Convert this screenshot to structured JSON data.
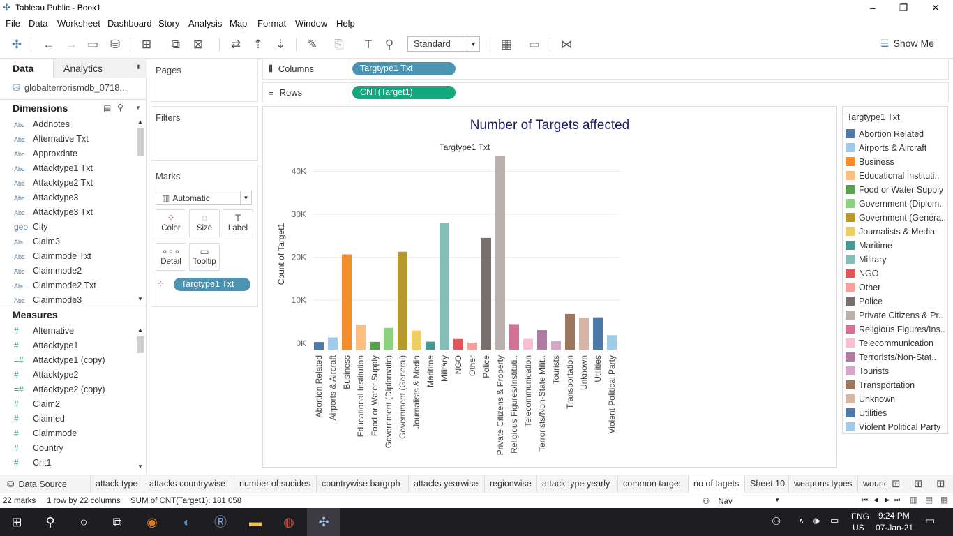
{
  "window": {
    "title": "Tableau Public - Book1"
  },
  "menu": [
    "File",
    "Data",
    "Worksheet",
    "Dashboard",
    "Story",
    "Analysis",
    "Map",
    "Format",
    "Window",
    "Help"
  ],
  "toolbar": {
    "fit_mode": "Standard",
    "show_me": "Show Me"
  },
  "left": {
    "tab_data": "Data",
    "tab_analytics": "Analytics",
    "datasource": "globalterrorismdb_0718...",
    "dimensions_label": "Dimensions",
    "dimensions": [
      {
        "type": "Abc",
        "name": "Addnotes"
      },
      {
        "type": "Abc",
        "name": "Alternative Txt"
      },
      {
        "type": "Abc",
        "name": "Approxdate"
      },
      {
        "type": "Abc",
        "name": "Attacktype1 Txt"
      },
      {
        "type": "Abc",
        "name": "Attacktype2 Txt"
      },
      {
        "type": "Abc",
        "name": "Attacktype3"
      },
      {
        "type": "Abc",
        "name": "Attacktype3 Txt"
      },
      {
        "type": "geo",
        "name": "City"
      },
      {
        "type": "Abc",
        "name": "Claim3"
      },
      {
        "type": "Abc",
        "name": "Claimmode Txt"
      },
      {
        "type": "Abc",
        "name": "Claimmode2"
      },
      {
        "type": "Abc",
        "name": "Claimmode2 Txt"
      },
      {
        "type": "Abc",
        "name": "Claimmode3"
      }
    ],
    "measures_label": "Measures",
    "measures": [
      {
        "type": "#",
        "name": "Alternative"
      },
      {
        "type": "#",
        "name": "Attacktype1"
      },
      {
        "type": "=#",
        "name": "Attacktype1 (copy)"
      },
      {
        "type": "#",
        "name": "Attacktype2"
      },
      {
        "type": "=#",
        "name": "Attacktype2 (copy)"
      },
      {
        "type": "#",
        "name": "Claim2"
      },
      {
        "type": "#",
        "name": "Claimed"
      },
      {
        "type": "#",
        "name": "Claimmode"
      },
      {
        "type": "#",
        "name": "Country"
      },
      {
        "type": "#",
        "name": "Crit1"
      }
    ]
  },
  "cards": {
    "pages": "Pages",
    "filters": "Filters",
    "marks": "Marks",
    "mark_type": "Automatic",
    "mark_buttons": [
      "Color",
      "Size",
      "Label",
      "Detail",
      "Tooltip"
    ],
    "color_pill": "Targtype1 Txt"
  },
  "shelves": {
    "columns_label": "Columns",
    "columns_pill": "Targtype1 Txt",
    "rows_label": "Rows",
    "rows_pill": "CNT(Target1)"
  },
  "chart_data": {
    "type": "bar",
    "title": "Number of Targets affected",
    "xlabel": "Targtype1 Txt",
    "ylabel": "Count of Target1",
    "ylim": [
      -1500,
      43000
    ],
    "yticks": [
      "0K",
      "10K",
      "20K",
      "30K",
      "40K"
    ],
    "ytick_values": [
      0,
      10000,
      20000,
      30000,
      40000
    ],
    "categories": [
      "Abortion Related",
      "Airports & Aircraft",
      "Business",
      "Educational Institution",
      "Food or Water Supply",
      "Government (Diplomatic)",
      "Government (General)",
      "Journalists & Media",
      "Maritime",
      "Military",
      "NGO",
      "Other",
      "Police",
      "Private Citizens & Property",
      "Religious Figures/Instituti..",
      "Telecommunication",
      "Terrorists/Non-State Milit..",
      "Tourists",
      "Transportation",
      "Unknown",
      "Utilities",
      "Violent Political Party"
    ],
    "values": [
      263,
      1343,
      20669,
      4322,
      317,
      3573,
      21283,
      2948,
      356,
      27984,
      970,
      137,
      24506,
      43511,
      4440,
      1009,
      3039,
      440,
      6799,
      5898,
      6023,
      1866
    ],
    "colors": [
      "#4e79a7",
      "#a0cbe8",
      "#f28e2b",
      "#ffbe7d",
      "#59a14f",
      "#8cd17d",
      "#b6992d",
      "#f1ce63",
      "#499894",
      "#86bcb6",
      "#e15759",
      "#ff9d9a",
      "#79706e",
      "#bab0ac",
      "#d37295",
      "#fabfd2",
      "#b07aa1",
      "#d4a6c8",
      "#9d7660",
      "#d7b5a6",
      "#4e79a7",
      "#a0cbe8"
    ]
  },
  "legend": {
    "title": "Targtype1 Txt",
    "items": [
      "Abortion Related",
      "Airports & Aircraft",
      "Business",
      "Educational Instituti..",
      "Food or Water Supply",
      "Government (Diplom..",
      "Government (Genera..",
      "Journalists & Media",
      "Maritime",
      "Military",
      "NGO",
      "Other",
      "Police",
      "Private Citizens & Pr..",
      "Religious Figures/Ins..",
      "Telecommunication",
      "Terrorists/Non-Stat..",
      "Tourists",
      "Transportation",
      "Unknown",
      "Utilities",
      "Violent Political Party"
    ]
  },
  "sheet_tabs": [
    "Data Source",
    "attack type",
    "attacks countrywise",
    "number of sucides",
    "countrywise bargrph",
    "attacks yearwise",
    "regionwise",
    "attack type yearly",
    "common target",
    "no of tagets",
    "Sheet 10",
    "weapons types",
    "wounded"
  ],
  "status": {
    "marks": "22 marks",
    "dims": "1 row by 22 columns",
    "sum": "SUM of CNT(Target1): 181,058",
    "user": "Nav"
  },
  "taskbar": {
    "lang1": "ENG",
    "lang2": "US",
    "time": "9:24 PM",
    "date": "07-Jan-21"
  }
}
